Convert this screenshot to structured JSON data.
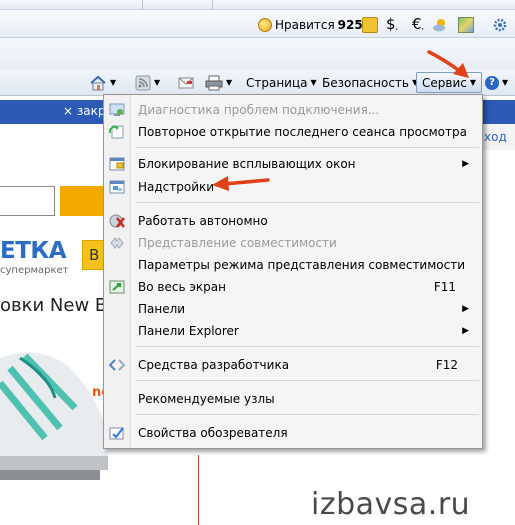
{
  "toolbar": {
    "like_label": "Нравится",
    "like_count": "925",
    "dollar_symbol": "$",
    "euro_symbol": "€"
  },
  "command_bar": {
    "page_label": "Страница",
    "security_label": "Безопасность",
    "service_label": "Сервис",
    "help_symbol": "?"
  },
  "page": {
    "tab_close_label": "×  закр",
    "outlink_text": "ход",
    "logo_text": "ЕТКА",
    "logo_sub": "супермаркет",
    "yellow_button_text": "В",
    "banner_title": "овки New B",
    "accent_text": "ne",
    "watermark": "izbavsa.ru"
  },
  "menu": {
    "items": [
      {
        "label": "Диагностика проблем подключения...",
        "shortcut": "",
        "submenu": false,
        "disabled": true,
        "icon": "diagnostics-icon"
      },
      {
        "label": "Повторное открытие последнего сеанса просмотра",
        "shortcut": "",
        "submenu": false,
        "disabled": false,
        "icon": "reopen-session-icon"
      },
      {
        "label": "Блокирование всплывающих окон",
        "shortcut": "",
        "submenu": true,
        "disabled": false,
        "icon": "popup-blocker-icon"
      },
      {
        "label": "Надстройки",
        "shortcut": "",
        "submenu": false,
        "disabled": false,
        "icon": "addons-icon"
      },
      {
        "label": "Работать автономно",
        "shortcut": "",
        "submenu": false,
        "disabled": false,
        "icon": "offline-icon"
      },
      {
        "label": "Представление совместимости",
        "shortcut": "",
        "submenu": false,
        "disabled": true,
        "icon": "compatibility-icon"
      },
      {
        "label": "Параметры режима представления совместимости",
        "shortcut": "",
        "submenu": false,
        "disabled": false,
        "icon": ""
      },
      {
        "label": "Во весь экран",
        "shortcut": "F11",
        "submenu": false,
        "disabled": false,
        "icon": "fullscreen-icon"
      },
      {
        "label": "Панели",
        "shortcut": "",
        "submenu": true,
        "disabled": false,
        "icon": ""
      },
      {
        "label": "Панели Explorer",
        "shortcut": "",
        "submenu": true,
        "disabled": false,
        "icon": ""
      },
      {
        "label": "Средства разработчика",
        "shortcut": "F12",
        "submenu": false,
        "disabled": false,
        "icon": "developer-tools-icon"
      },
      {
        "label": "Рекомендуемые узлы",
        "shortcut": "",
        "submenu": false,
        "disabled": false,
        "icon": ""
      },
      {
        "label": "Свойства обозревателя",
        "shortcut": "",
        "submenu": false,
        "disabled": false,
        "icon": "internet-options-icon"
      }
    ],
    "submenu_arrow": "▶"
  },
  "colors": {
    "tab_bar": "#2d59b6",
    "annotation_arrow": "#e0401a",
    "search_button": "#f5a800",
    "logo": "#2b6cc4"
  }
}
